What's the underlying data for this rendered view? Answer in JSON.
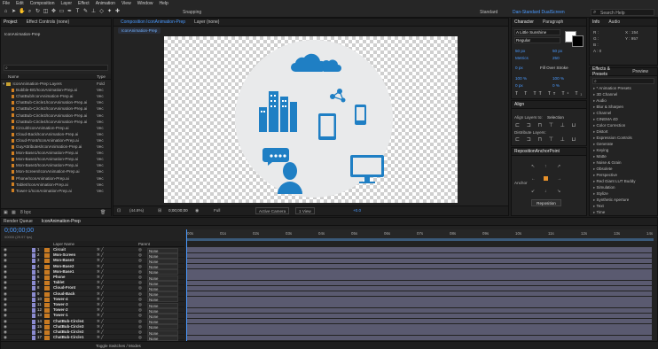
{
  "menu": [
    "File",
    "Edit",
    "Composition",
    "Layer",
    "Effect",
    "Animation",
    "View",
    "Window",
    "Help"
  ],
  "toolbar": {
    "snapping": "Snapping",
    "ws_standard": "Standard",
    "ws_dual": "Dan-Standard DualScreen",
    "search": "Search Help"
  },
  "project": {
    "tab_project": "Project",
    "tab_effects": "Effect Controls (none)",
    "item": "IconAnimation-Prep",
    "search_placeholder": "",
    "col_name": "Name",
    "col_type": "Type",
    "files": [
      {
        "name": "IconAnimation-Prep Layers",
        "type": "Fold"
      },
      {
        "name": "Bubble-BG/IconAnimation-Prep.ai",
        "type": "Vec"
      },
      {
        "name": "ChatBub/IconAnimation-Prep.ai",
        "type": "Vec"
      },
      {
        "name": "ChatBub-Circle1/IconAnimation-Prep.ai",
        "type": "Vec"
      },
      {
        "name": "ChatBub-Circle2/IconAnimation-Prep.ai",
        "type": "Vec"
      },
      {
        "name": "ChatBub-Circle3/IconAnimation-Prep.ai",
        "type": "Vec"
      },
      {
        "name": "ChatBub-Circle4/IconAnimation-Prep.ai",
        "type": "Vec"
      },
      {
        "name": "Circuit/IconAnimation-Prep.ai",
        "type": "Vec"
      },
      {
        "name": "Cloud-Back/IconAnimation-Prep.ai",
        "type": "Vec"
      },
      {
        "name": "Cloud-Front/IconAnimation-Prep.ai",
        "type": "Vec"
      },
      {
        "name": "GuyAttributes/IconAnimation-Prep.ai",
        "type": "Vec"
      },
      {
        "name": "Mon-Base1/IconAnimation-Prep.ai",
        "type": "Vec"
      },
      {
        "name": "Mon-Base2/IconAnimation-Prep.ai",
        "type": "Vec"
      },
      {
        "name": "Mon-Base3/IconAnimation-Prep.ai",
        "type": "Vec"
      },
      {
        "name": "Mon-Screen/IconAnimation-Prep.ai",
        "type": "Vec"
      },
      {
        "name": "Phone/IconAnimation-Prep.ai",
        "type": "Vec"
      },
      {
        "name": "Tablet/IconAnimation-Prep.ai",
        "type": "Vec"
      },
      {
        "name": "Tower-1/IconAnimation-Prep.ai",
        "type": "Vec"
      }
    ]
  },
  "comp": {
    "tab_comp": "Composition IconAnimation-Prep",
    "tab_layer": "Layer (none)",
    "breadcrumb": "IconAnimation-Prep",
    "zoom": "(44.8%)",
    "timecode": "0;00;00;00",
    "quality": "Full",
    "camera": "Active Camera",
    "view": "1 View",
    "exposure": "+0.0"
  },
  "character": {
    "tab": "Character",
    "tab2": "Paragraph",
    "font": "A Little Sunshine",
    "style": "Regular",
    "size": "50 px",
    "leading": "50 px",
    "kerning": "Metrics",
    "tracking": "250",
    "stroke": "0 px",
    "stroke_type": "Fill Over Stroke",
    "vscale": "100 %",
    "hscale": "100 %",
    "baseline": "0 px",
    "tsume": "0 %"
  },
  "info": {
    "tab": "Info",
    "tab2": "Audio",
    "r": "R :",
    "g": "G :",
    "b": "B :",
    "a": "A : 0",
    "x": "X : 154",
    "y": "Y : 957"
  },
  "effects": {
    "tab": "Effects & Presets",
    "tab2": "Preview",
    "search": "",
    "items": [
      "* Animation Presets",
      "3D Channel",
      "Audio",
      "Blur & Sharpen",
      "Channel",
      "CINEMA 4D",
      "Color Correction",
      "Distort",
      "Expression Controls",
      "Generate",
      "Keying",
      "Matte",
      "Noise & Grain",
      "Obsolete",
      "Perspective",
      "Red Giant LUT Buddy",
      "Simulation",
      "Stylize",
      "Synthetic Aperture",
      "Text",
      "Time"
    ]
  },
  "align": {
    "tab": "Align",
    "label": "Align Layers to:",
    "target": "Selection",
    "distribute": "Distribute Layers:"
  },
  "reposition": {
    "tab": "RepositionAnchorPoint",
    "anchor": "Anchor",
    "button": "Reposition"
  },
  "timeline": {
    "tab_render": "Render Queue",
    "tab_comp": "IconAnimation-Prep",
    "timecode": "0;00;00;00",
    "fps": "00000 (29.97 fps)",
    "col_source": "Layer Name",
    "col_parent": "Parent",
    "toggle": "Toggle Switches / Modes",
    "ruler": [
      "00s",
      "01s",
      "02s",
      "03s",
      "04s",
      "05s",
      "06s",
      "07s",
      "08s",
      "09s",
      "10s",
      "11s",
      "12s",
      "13s",
      "14s"
    ],
    "layers": [
      {
        "n": "1",
        "name": "Circuit",
        "parent": "None"
      },
      {
        "n": "2",
        "name": "Mon-Screen",
        "parent": "None"
      },
      {
        "n": "3",
        "name": "Mon-Base3",
        "parent": "None"
      },
      {
        "n": "4",
        "name": "Mon-Base2",
        "parent": "None"
      },
      {
        "n": "5",
        "name": "Mon-Base1",
        "parent": "None"
      },
      {
        "n": "6",
        "name": "Phone",
        "parent": "None"
      },
      {
        "n": "7",
        "name": "Tablet",
        "parent": "None"
      },
      {
        "n": "8",
        "name": "Cloud-Front",
        "parent": "None"
      },
      {
        "n": "9",
        "name": "Cloud-Back",
        "parent": "None"
      },
      {
        "n": "10",
        "name": "Tower-4",
        "parent": "None"
      },
      {
        "n": "11",
        "name": "Tower-3",
        "parent": "None"
      },
      {
        "n": "12",
        "name": "Tower-2",
        "parent": "None"
      },
      {
        "n": "13",
        "name": "Tower-1",
        "parent": "None"
      },
      {
        "n": "14",
        "name": "ChatBub-Circle4",
        "parent": "None"
      },
      {
        "n": "15",
        "name": "ChatBub-Circle3",
        "parent": "None"
      },
      {
        "n": "16",
        "name": "ChatBub-Circle2",
        "parent": "None"
      },
      {
        "n": "17",
        "name": "ChatBub-Circle1",
        "parent": "None"
      }
    ]
  },
  "colors": {
    "accent": "#4a9aff",
    "bar": "#5a5a70",
    "label_orange": "#d07f22",
    "icon_blue": "#1f7fc4"
  }
}
